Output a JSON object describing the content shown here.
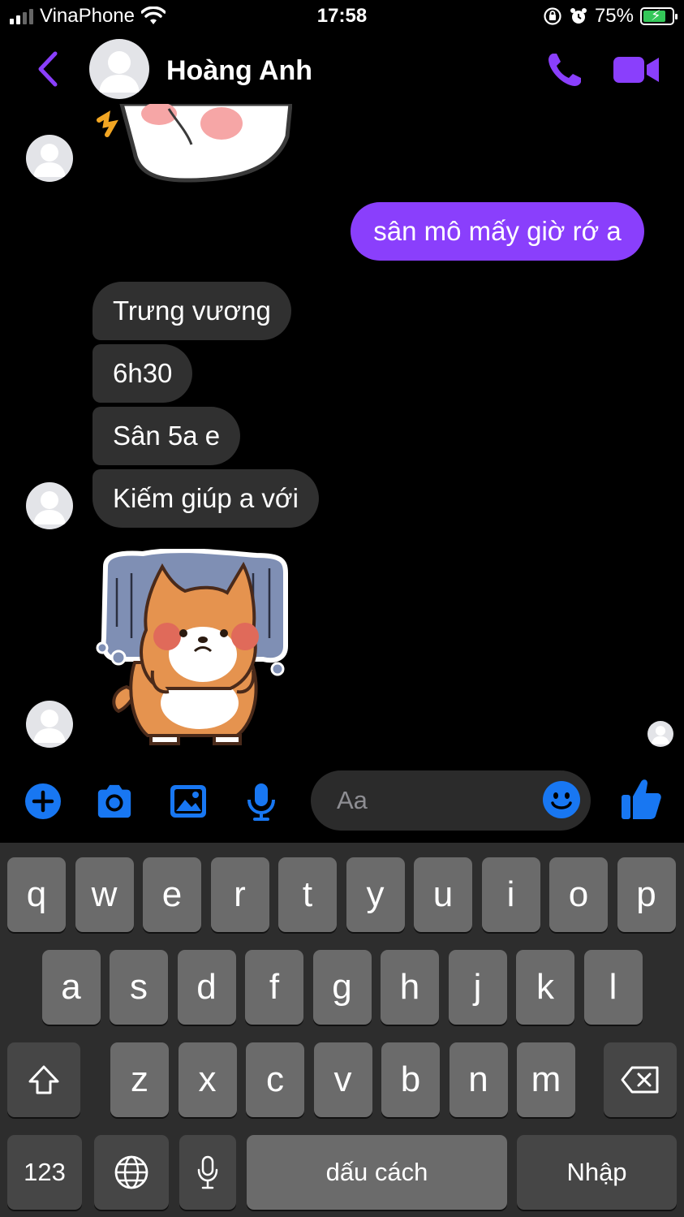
{
  "status_bar": {
    "carrier": "VinaPhone",
    "time": "17:58",
    "battery": "75%"
  },
  "header": {
    "contact_name": "Hoàng Anh"
  },
  "messages": {
    "outgoing_1": "sân mô mấy giờ rớ a",
    "incoming_1": "Trưng vương",
    "incoming_2": "6h30",
    "incoming_3": "Sân 5a e",
    "incoming_4": "Kiếm giúp a với"
  },
  "composer": {
    "placeholder": "Aa"
  },
  "keyboard": {
    "row1": [
      "q",
      "w",
      "e",
      "r",
      "t",
      "y",
      "u",
      "i",
      "o",
      "p"
    ],
    "row2": [
      "a",
      "s",
      "d",
      "f",
      "g",
      "h",
      "j",
      "k",
      "l"
    ],
    "row3": [
      "z",
      "x",
      "c",
      "v",
      "b",
      "n",
      "m"
    ],
    "numbers_label": "123",
    "space_label": "dấu cách",
    "return_label": "Nhập"
  },
  "colors": {
    "accent": "#8a3ffc",
    "composer_icons": "#1877f2",
    "incoming_bubble": "#303030"
  },
  "icons": [
    "back-chevron-icon",
    "phone-icon",
    "video-camera-icon",
    "plus-icon",
    "camera-icon",
    "image-icon",
    "microphone-icon",
    "emoji-icon",
    "thumbs-up-icon",
    "shift-icon",
    "backspace-icon",
    "globe-icon",
    "dictation-icon"
  ]
}
